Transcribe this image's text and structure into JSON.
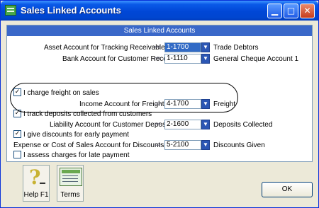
{
  "window": {
    "title": "Sales Linked Accounts"
  },
  "panel": {
    "header": "Sales Linked Accounts"
  },
  "rows": {
    "tracking": {
      "label": "Asset Account for Tracking Receivables",
      "account": "1-1700",
      "name": "Trade Debtors"
    },
    "receipts": {
      "label": "Bank Account for Customer Receipts",
      "account": "1-1110",
      "name": "General Cheque Account 1"
    },
    "freight_check": {
      "label": "I charge freight on sales",
      "checked": true
    },
    "freight_income": {
      "label": "Income Account for Freight",
      "account": "4-1700",
      "name": "Freight"
    },
    "deposits_check": {
      "label": "I track deposits collected from customers",
      "checked": true
    },
    "deposits_liability": {
      "label": "Liability Account for Customer Deposits",
      "account": "2-1600",
      "name": "Deposits Collected"
    },
    "discounts_check": {
      "label": "I give discounts for early payment",
      "checked": true
    },
    "discounts_expense": {
      "label": "Expense or Cost of Sales Account for Discounts",
      "account": "5-2100",
      "name": "Discounts Given"
    },
    "late_check": {
      "label": "I assess charges for late payment",
      "checked": false
    }
  },
  "glyphs": {
    "arrow": "⇨",
    "dropdown": "▼",
    "check": "✓",
    "minimize": "▁",
    "maximize": "□",
    "close": "✕",
    "question": "?"
  },
  "footer": {
    "help_label": "Help F1",
    "terms_label": "Terms",
    "ok_label": "OK"
  },
  "icons": {
    "help": "help-icon",
    "terms": "terms-card-icon",
    "app": "app-icon"
  }
}
